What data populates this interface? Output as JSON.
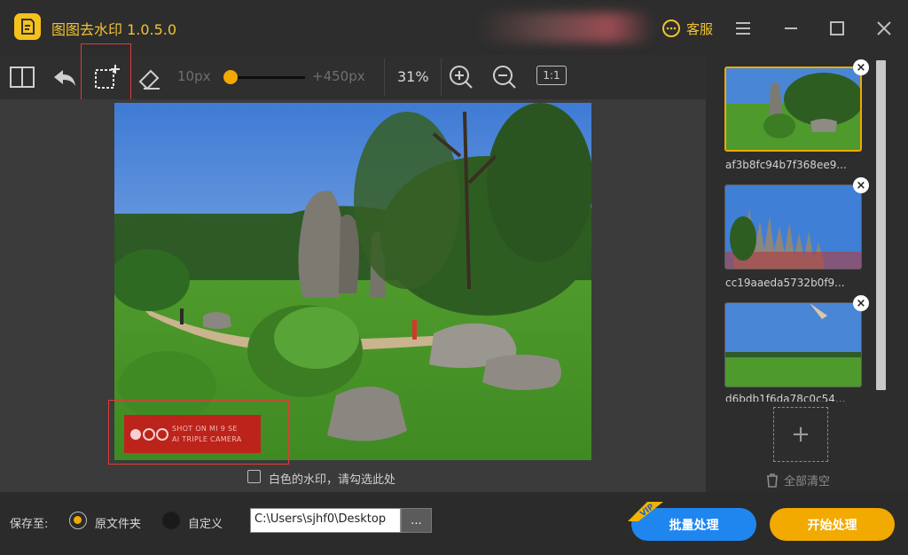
{
  "app": {
    "title": "图图去水印  1.0.5.0",
    "service_label": "客服"
  },
  "toolbar": {
    "brush_min": "10px",
    "brush_max": "+450px",
    "brush_level_fraction": 0.05,
    "zoom": "31%",
    "actual_size": "1:1"
  },
  "canvas": {
    "watermark_line1": "SHOT ON MI 9 SE",
    "watermark_line2": "AI TRIPLE CAMERA",
    "white_watermark_label": "白色的水印，请勾选此处"
  },
  "queue": {
    "items": [
      {
        "name": "af3b8fc94b7f368ee9...",
        "selected": true
      },
      {
        "name": "cc19aaeda5732b0f9...",
        "selected": false
      },
      {
        "name": "d6bdb1f6da78c0c54...",
        "selected": false
      }
    ],
    "clear_all": "全部清空"
  },
  "footer": {
    "save_to": "保存至:",
    "option_original": "原文件夹",
    "option_custom": "自定义",
    "path": "C:\\Users\\sjhf0\\Desktop",
    "browse": "...",
    "batch_label": "批量处理",
    "vip": "VIP",
    "start_label": "开始处理"
  },
  "colors": {
    "accent": "#f2a900",
    "batch_blue": "#1f86f0",
    "selection_red": "#e03a3a"
  }
}
